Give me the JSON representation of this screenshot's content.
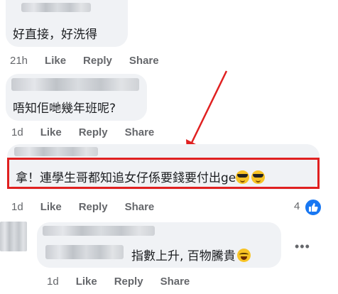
{
  "comments": [
    {
      "text": "好直接，好洗得",
      "actions": {
        "time": "21h",
        "like": "Like",
        "reply": "Reply",
        "share": "Share"
      }
    },
    {
      "text": "唔知佢哋幾年班呢?",
      "actions": {
        "time": "1d",
        "like": "Like",
        "reply": "Reply",
        "share": "Share"
      }
    },
    {
      "text": "拿！連學生哥都知追女仔係要錢要付出ge",
      "emoji": [
        "smiling-face-with-sunglasses",
        "smiling-face-with-sunglasses"
      ],
      "actions": {
        "time": "1d",
        "like": "Like",
        "reply": "Reply",
        "share": "Share"
      },
      "like_count": "4"
    },
    {
      "text": "指數上升, 百物騰貴",
      "emoji": [
        "grinning-squinting-face"
      ],
      "actions": {
        "time": "1d",
        "like": "Like",
        "reply": "Reply",
        "share": "Share"
      }
    }
  ],
  "colors": {
    "bubble": "#f0f2f5",
    "meta_text": "#65676b",
    "highlight": "#e02020",
    "like_blue": "#1877f2"
  },
  "icons": [
    "more-options-icon",
    "like-thumb-icon",
    "red-arrow-annotation"
  ]
}
